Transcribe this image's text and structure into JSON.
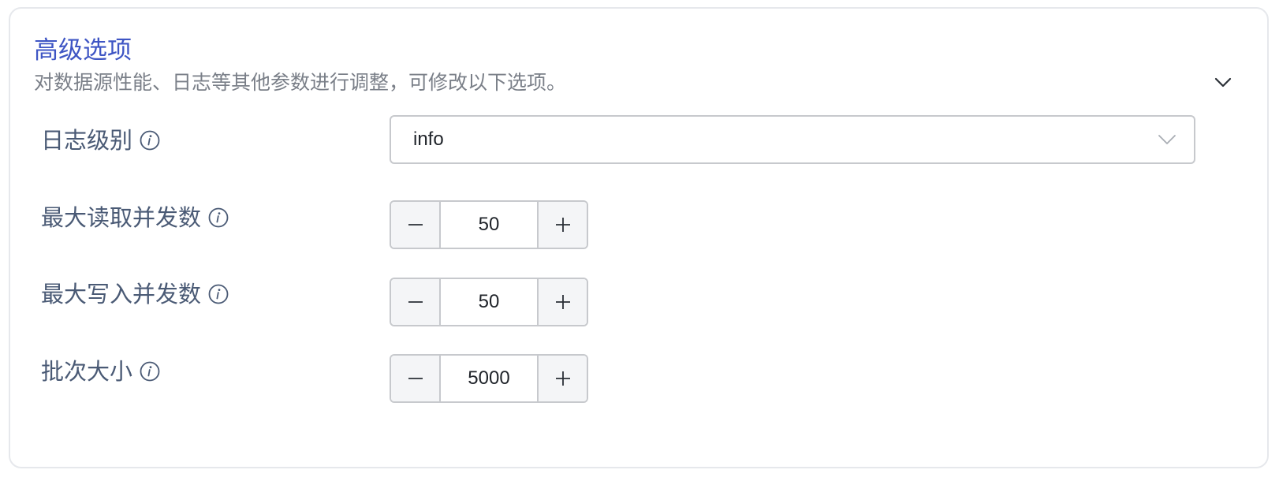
{
  "section": {
    "title": "高级选项",
    "description": "对数据源性能、日志等其他参数进行调整，可修改以下选项。",
    "collapse_icon": "chevron-down-icon"
  },
  "fields": {
    "log_level": {
      "label": "日志级别",
      "value": "info",
      "info_icon": "info-icon"
    },
    "max_read_concurrency": {
      "label": "最大读取并发数",
      "value": "50"
    },
    "max_write_concurrency": {
      "label": "最大写入并发数",
      "value": "50"
    },
    "batch_size": {
      "label": "批次大小",
      "value": "5000"
    }
  },
  "colors": {
    "title": "#3e55c4",
    "label": "#4a5a75",
    "description": "#7a7f88",
    "border": "#c7c9cd",
    "button_bg": "#f4f5f7"
  }
}
